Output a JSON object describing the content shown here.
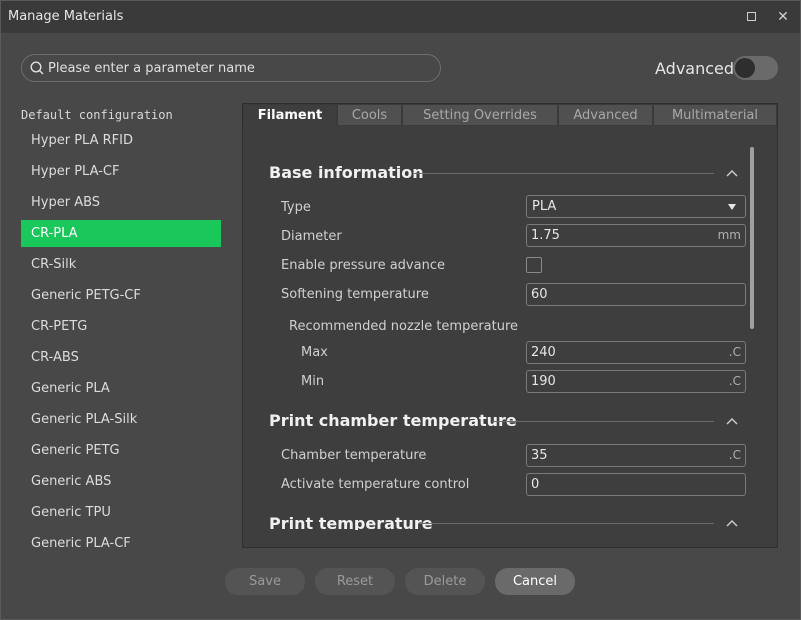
{
  "window": {
    "title": "Manage Materials"
  },
  "search": {
    "placeholder": "Please enter a parameter name"
  },
  "advanced": {
    "label": "Advanced"
  },
  "sidebar": {
    "header": "Default configuration",
    "items": [
      "Hyper PLA RFID",
      "Hyper PLA-CF",
      "Hyper ABS",
      "CR-PLA",
      "CR-Silk",
      "Generic PETG-CF",
      "CR-PETG",
      "CR-ABS",
      "Generic PLA",
      "Generic PLA-Silk",
      "Generic PETG",
      "Generic ABS",
      "Generic TPU",
      "Generic PLA-CF"
    ],
    "selected": "CR-PLA"
  },
  "tabs": [
    "Filament",
    "Cools",
    "Setting Overrides",
    "Advanced",
    "Multimaterial"
  ],
  "active_tab": "Filament",
  "sections": {
    "base": {
      "title": "Base information",
      "type_label": "Type",
      "type_value": "PLA",
      "diameter_label": "Diameter",
      "diameter_value": "1.75",
      "diameter_unit": "mm",
      "pressure_label": "Enable pressure advance",
      "softening_label": "Softening temperature",
      "softening_value": "60",
      "nozzle_group_label": "Recommended nozzle temperature",
      "max_label": "Max",
      "max_value": "240",
      "min_label": "Min",
      "min_value": "190",
      "temp_unit": ".C"
    },
    "chamber": {
      "title": "Print chamber temperature",
      "chamber_label": "Chamber temperature",
      "chamber_value": "35",
      "activate_label": "Activate temperature control",
      "activate_value": "0"
    },
    "print_temp": {
      "title": "Print temperature"
    }
  },
  "buttons": {
    "save": "Save",
    "reset": "Reset",
    "delete": "Delete",
    "cancel": "Cancel"
  }
}
